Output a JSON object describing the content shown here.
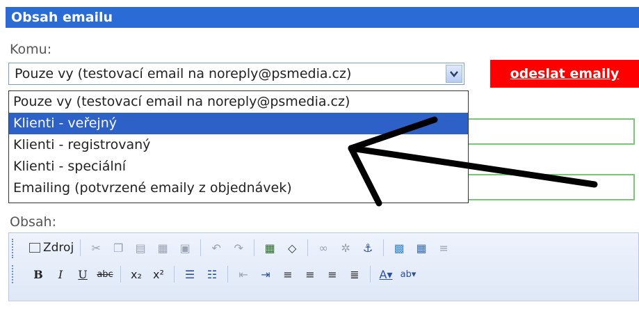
{
  "header": {
    "title": "Obsah emailu"
  },
  "recipient": {
    "label": "Komu:",
    "selected": "Pouze vy (testovací email na noreply@psmedia.cz)",
    "options": [
      "Pouze vy (testovací email na noreply@psmedia.cz)",
      "Klienti - veřejný",
      "Klienti - registrovaný",
      "Klienti - speciální",
      "Emailing (potvrzené emaily z objednávek)"
    ],
    "highlighted_index": 1
  },
  "send_button": {
    "label": "odeslat emaily"
  },
  "content": {
    "label": "Obsah:"
  },
  "toolbar": {
    "source_label": "Zdroj",
    "row1": [
      "cut-icon",
      "copy-icon",
      "paste-icon",
      "paste-text-icon",
      "paste-word-icon",
      "undo-icon",
      "redo-icon",
      "select-all-icon",
      "eraser-icon",
      "link-icon",
      "unlink-icon",
      "anchor-icon",
      "image-icon",
      "table-icon",
      "horizontal-rule-icon"
    ],
    "row2": [
      "bold-icon",
      "italic-icon",
      "underline-icon",
      "strike-icon",
      "subscript-icon",
      "superscript-icon",
      "ordered-list-icon",
      "unordered-list-icon",
      "outdent-icon",
      "indent-icon",
      "align-left-icon",
      "align-center-icon",
      "align-right-icon",
      "justify-icon",
      "text-color-icon",
      "bg-color-icon"
    ]
  },
  "colors": {
    "header": "#2a6bd6",
    "send": "#ff0000",
    "selection": "#2e61c8",
    "field_border": "#7ac47a"
  }
}
